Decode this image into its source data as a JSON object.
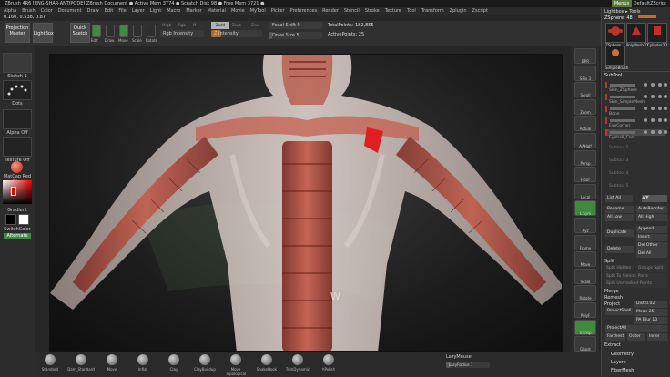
{
  "titlebar": {
    "text": "ZBrush 4R6 [ENG-SHAR-ANTIPODE]   ZBrush Document   ● Active Mem 3774 ● Scratch Disk 98 ● Free Mem 3721 ●",
    "menus_btn": "Menus",
    "script": "DefaultZScript"
  },
  "menubar": [
    "Alpha",
    "Brush",
    "Color",
    "Document",
    "Draw",
    "Edit",
    "File",
    "Layer",
    "Light",
    "Macro",
    "Marker",
    "Material",
    "Movie",
    "MyTool",
    "Picker",
    "Preferences",
    "Render",
    "Stencil",
    "Stroke",
    "Texture",
    "Tool",
    "Transform",
    "Zplugin",
    "Zscript"
  ],
  "coords": "0.160, 0.538, 0.87",
  "toolbar": {
    "projection_master": "Projection Master",
    "lightbox": "LightBox",
    "quick_sketch": "Quick Sketch",
    "edit": "Edit",
    "draw": "Draw",
    "move": "Move",
    "scale": "Scale",
    "rotate": "Rotate",
    "mrgb": "Mrgb",
    "rgb": "Rgb",
    "m": "M",
    "zadd": "Zadd",
    "zsub": "Zsub",
    "zcut": "Zcut",
    "rgb_intensity": "Rgb Intensity",
    "z_intensity": "Z Intensity",
    "focal_shift": "Focal Shift 0",
    "draw_size": "Draw Size 5",
    "total_points": "TotalPoints: 182,855",
    "active_points": "ActivePoints: 25"
  },
  "left": {
    "brush_label": "Sketch 1",
    "dots": "Dots",
    "alpha": "Alpha Off",
    "texture": "Texture Off",
    "material": "MatCap Red Wax",
    "gradient": "Gradient",
    "switch_color": "SwitchColor",
    "alternate": "Alternate"
  },
  "right_shelf": [
    "BPR",
    "SPix 3",
    "Scroll",
    "Zoom",
    "Actual",
    "AAHalf",
    "Persp",
    "Floor",
    "Local",
    "L.Sym",
    "Xyz",
    "Frame",
    "Move",
    "Scale",
    "Rotate",
    "PolyF",
    "Transp",
    "Ghost",
    "Solo"
  ],
  "canvas": {
    "cursor_letter": "W"
  },
  "bottom": {
    "brushes": [
      "Standard",
      "Dam_Standard",
      "Move",
      "Inflat",
      "Clay",
      "ClayBuildup",
      "Move Topological",
      "SnakeHook",
      "TrimDynamic",
      "hPolish"
    ],
    "lazymouse": "LazyMouse",
    "lazyradius": "LazyRadius 1"
  },
  "panel": {
    "title": "Lightbox ▸ Tools",
    "zsphere": "ZSphere: 48",
    "tools": [
      "ZSphere",
      "PolyMesh3D",
      "Cylinder3D",
      "SimpleBrush"
    ],
    "subtool": "SubTool",
    "subtools": [
      "Skin_ZSphere",
      "Skin_SimpleMesh",
      "Bone",
      "EyeCorner",
      "Eyeball_Corr"
    ],
    "list_all": "List All",
    "rename": "Rename",
    "autoreorder": "AutoReorder",
    "all_low": "All Low",
    "all_high": "All High",
    "duplicate": "Duplicate",
    "append": "Append",
    "insert": "Insert",
    "delete": "Delete",
    "del_other": "Del Other",
    "del_all": "Del All",
    "split": "Split",
    "split_hidden": "Split Hidden",
    "groups_split": "Groups Split",
    "split_similar": "Split To Similar Parts",
    "split_unmasked": "Split Unmasked Points",
    "merge": "Merge",
    "remesh": "Remesh",
    "project": "Project",
    "project_shell": "ProjectShell",
    "projectall": "ProjectAll",
    "dist": "Dist 0.02",
    "mean": "Mean 25",
    "pa_blur": "PA Blur 10",
    "farthest": "Farthest",
    "outer": "Outer",
    "inner": "Inner",
    "extract": "Extract",
    "geometry": "Geometry",
    "layers": "Layers",
    "fibermesh": "FiberMesh",
    "sel_slots": [
      "Subtool 2",
      "Subtool 3",
      "Subtool 4",
      "Subtool 5",
      "Subtool 6",
      "Subtool 7"
    ]
  },
  "colors": {
    "accent_green": "#3f8a3f",
    "tool_red": "#c0302a",
    "skin": "#e8d8d0",
    "muscle": "#b04a3a"
  }
}
